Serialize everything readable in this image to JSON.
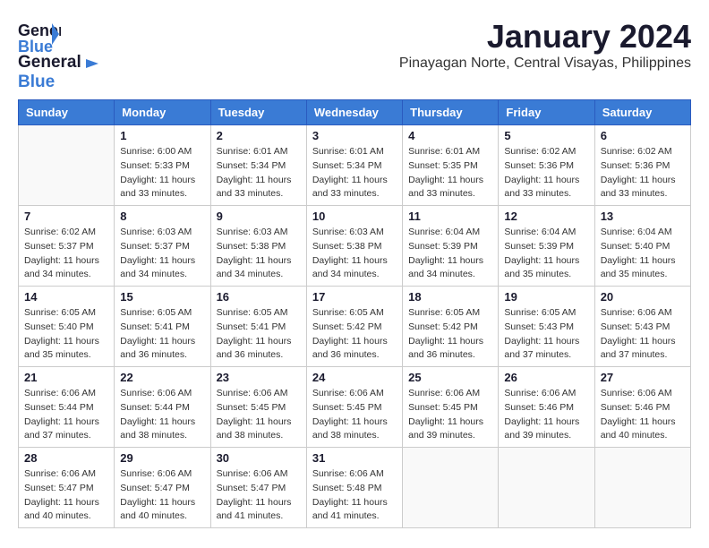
{
  "logo": {
    "general": "General",
    "blue": "Blue"
  },
  "title": "January 2024",
  "subtitle": "Pinayagan Norte, Central Visayas, Philippines",
  "headers": [
    "Sunday",
    "Monday",
    "Tuesday",
    "Wednesday",
    "Thursday",
    "Friday",
    "Saturday"
  ],
  "weeks": [
    [
      {
        "day": "",
        "sunrise": "",
        "sunset": "",
        "daylight": ""
      },
      {
        "day": "1",
        "sunrise": "Sunrise: 6:00 AM",
        "sunset": "Sunset: 5:33 PM",
        "daylight": "Daylight: 11 hours and 33 minutes."
      },
      {
        "day": "2",
        "sunrise": "Sunrise: 6:01 AM",
        "sunset": "Sunset: 5:34 PM",
        "daylight": "Daylight: 11 hours and 33 minutes."
      },
      {
        "day": "3",
        "sunrise": "Sunrise: 6:01 AM",
        "sunset": "Sunset: 5:34 PM",
        "daylight": "Daylight: 11 hours and 33 minutes."
      },
      {
        "day": "4",
        "sunrise": "Sunrise: 6:01 AM",
        "sunset": "Sunset: 5:35 PM",
        "daylight": "Daylight: 11 hours and 33 minutes."
      },
      {
        "day": "5",
        "sunrise": "Sunrise: 6:02 AM",
        "sunset": "Sunset: 5:36 PM",
        "daylight": "Daylight: 11 hours and 33 minutes."
      },
      {
        "day": "6",
        "sunrise": "Sunrise: 6:02 AM",
        "sunset": "Sunset: 5:36 PM",
        "daylight": "Daylight: 11 hours and 33 minutes."
      }
    ],
    [
      {
        "day": "7",
        "sunrise": "Sunrise: 6:02 AM",
        "sunset": "Sunset: 5:37 PM",
        "daylight": "Daylight: 11 hours and 34 minutes."
      },
      {
        "day": "8",
        "sunrise": "Sunrise: 6:03 AM",
        "sunset": "Sunset: 5:37 PM",
        "daylight": "Daylight: 11 hours and 34 minutes."
      },
      {
        "day": "9",
        "sunrise": "Sunrise: 6:03 AM",
        "sunset": "Sunset: 5:38 PM",
        "daylight": "Daylight: 11 hours and 34 minutes."
      },
      {
        "day": "10",
        "sunrise": "Sunrise: 6:03 AM",
        "sunset": "Sunset: 5:38 PM",
        "daylight": "Daylight: 11 hours and 34 minutes."
      },
      {
        "day": "11",
        "sunrise": "Sunrise: 6:04 AM",
        "sunset": "Sunset: 5:39 PM",
        "daylight": "Daylight: 11 hours and 34 minutes."
      },
      {
        "day": "12",
        "sunrise": "Sunrise: 6:04 AM",
        "sunset": "Sunset: 5:39 PM",
        "daylight": "Daylight: 11 hours and 35 minutes."
      },
      {
        "day": "13",
        "sunrise": "Sunrise: 6:04 AM",
        "sunset": "Sunset: 5:40 PM",
        "daylight": "Daylight: 11 hours and 35 minutes."
      }
    ],
    [
      {
        "day": "14",
        "sunrise": "Sunrise: 6:05 AM",
        "sunset": "Sunset: 5:40 PM",
        "daylight": "Daylight: 11 hours and 35 minutes."
      },
      {
        "day": "15",
        "sunrise": "Sunrise: 6:05 AM",
        "sunset": "Sunset: 5:41 PM",
        "daylight": "Daylight: 11 hours and 36 minutes."
      },
      {
        "day": "16",
        "sunrise": "Sunrise: 6:05 AM",
        "sunset": "Sunset: 5:41 PM",
        "daylight": "Daylight: 11 hours and 36 minutes."
      },
      {
        "day": "17",
        "sunrise": "Sunrise: 6:05 AM",
        "sunset": "Sunset: 5:42 PM",
        "daylight": "Daylight: 11 hours and 36 minutes."
      },
      {
        "day": "18",
        "sunrise": "Sunrise: 6:05 AM",
        "sunset": "Sunset: 5:42 PM",
        "daylight": "Daylight: 11 hours and 36 minutes."
      },
      {
        "day": "19",
        "sunrise": "Sunrise: 6:05 AM",
        "sunset": "Sunset: 5:43 PM",
        "daylight": "Daylight: 11 hours and 37 minutes."
      },
      {
        "day": "20",
        "sunrise": "Sunrise: 6:06 AM",
        "sunset": "Sunset: 5:43 PM",
        "daylight": "Daylight: 11 hours and 37 minutes."
      }
    ],
    [
      {
        "day": "21",
        "sunrise": "Sunrise: 6:06 AM",
        "sunset": "Sunset: 5:44 PM",
        "daylight": "Daylight: 11 hours and 37 minutes."
      },
      {
        "day": "22",
        "sunrise": "Sunrise: 6:06 AM",
        "sunset": "Sunset: 5:44 PM",
        "daylight": "Daylight: 11 hours and 38 minutes."
      },
      {
        "day": "23",
        "sunrise": "Sunrise: 6:06 AM",
        "sunset": "Sunset: 5:45 PM",
        "daylight": "Daylight: 11 hours and 38 minutes."
      },
      {
        "day": "24",
        "sunrise": "Sunrise: 6:06 AM",
        "sunset": "Sunset: 5:45 PM",
        "daylight": "Daylight: 11 hours and 38 minutes."
      },
      {
        "day": "25",
        "sunrise": "Sunrise: 6:06 AM",
        "sunset": "Sunset: 5:45 PM",
        "daylight": "Daylight: 11 hours and 39 minutes."
      },
      {
        "day": "26",
        "sunrise": "Sunrise: 6:06 AM",
        "sunset": "Sunset: 5:46 PM",
        "daylight": "Daylight: 11 hours and 39 minutes."
      },
      {
        "day": "27",
        "sunrise": "Sunrise: 6:06 AM",
        "sunset": "Sunset: 5:46 PM",
        "daylight": "Daylight: 11 hours and 40 minutes."
      }
    ],
    [
      {
        "day": "28",
        "sunrise": "Sunrise: 6:06 AM",
        "sunset": "Sunset: 5:47 PM",
        "daylight": "Daylight: 11 hours and 40 minutes."
      },
      {
        "day": "29",
        "sunrise": "Sunrise: 6:06 AM",
        "sunset": "Sunset: 5:47 PM",
        "daylight": "Daylight: 11 hours and 40 minutes."
      },
      {
        "day": "30",
        "sunrise": "Sunrise: 6:06 AM",
        "sunset": "Sunset: 5:47 PM",
        "daylight": "Daylight: 11 hours and 41 minutes."
      },
      {
        "day": "31",
        "sunrise": "Sunrise: 6:06 AM",
        "sunset": "Sunset: 5:48 PM",
        "daylight": "Daylight: 11 hours and 41 minutes."
      },
      {
        "day": "",
        "sunrise": "",
        "sunset": "",
        "daylight": ""
      },
      {
        "day": "",
        "sunrise": "",
        "sunset": "",
        "daylight": ""
      },
      {
        "day": "",
        "sunrise": "",
        "sunset": "",
        "daylight": ""
      }
    ]
  ]
}
